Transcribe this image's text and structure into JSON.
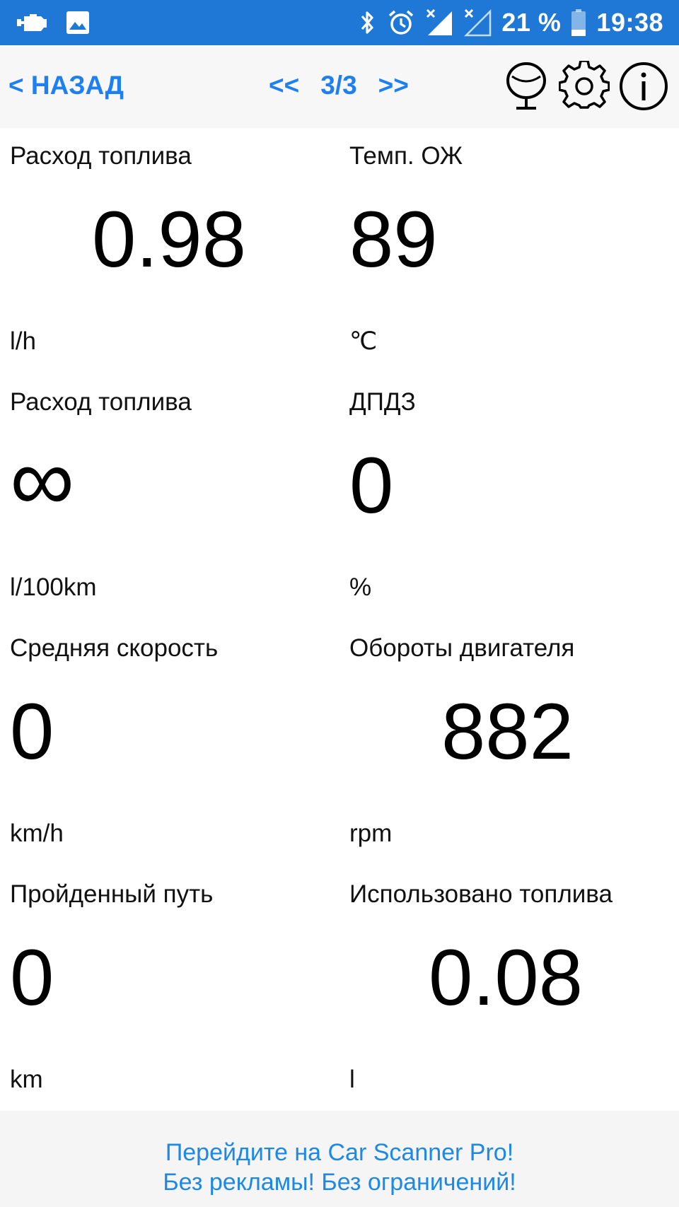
{
  "status_bar": {
    "icons_left": [
      "check-engine-icon",
      "image-icon"
    ],
    "icons_right": [
      "bluetooth-icon",
      "alarm-icon",
      "signal-icon",
      "signal-icon-2",
      "battery-icon"
    ],
    "battery": "21 %",
    "time": "19:38",
    "bg_color": "#1f78d6"
  },
  "header": {
    "back_label": "< НАЗАД",
    "prev_label": "<<",
    "page": "3/3",
    "next_label": ">>",
    "icons": [
      "mirror-icon",
      "gear-icon",
      "info-icon"
    ],
    "accent_color": "#1e7ff0"
  },
  "gauges": [
    {
      "label": "Расход топлива",
      "value": "0.98",
      "unit": "l/h"
    },
    {
      "label": "Темп. ОЖ",
      "value": "89",
      "unit": "℃"
    },
    {
      "label": "Расход топлива",
      "value": "∞",
      "unit": "l/100km"
    },
    {
      "label": "ДПДЗ",
      "value": "0",
      "unit": "%"
    },
    {
      "label": "Средняя скорость",
      "value": "0",
      "unit": "km/h"
    },
    {
      "label": "Обороты двигателя",
      "value": "882",
      "unit": "rpm"
    },
    {
      "label": "Пройденный путь",
      "value": "0",
      "unit": "km"
    },
    {
      "label": "Использовано топлива",
      "value": "0.08",
      "unit": "l"
    }
  ],
  "footer": {
    "line1": "Перейдите на Car Scanner Pro!",
    "line2": "Без рекламы! Без ограничений!",
    "link_color": "#1e88e5"
  }
}
